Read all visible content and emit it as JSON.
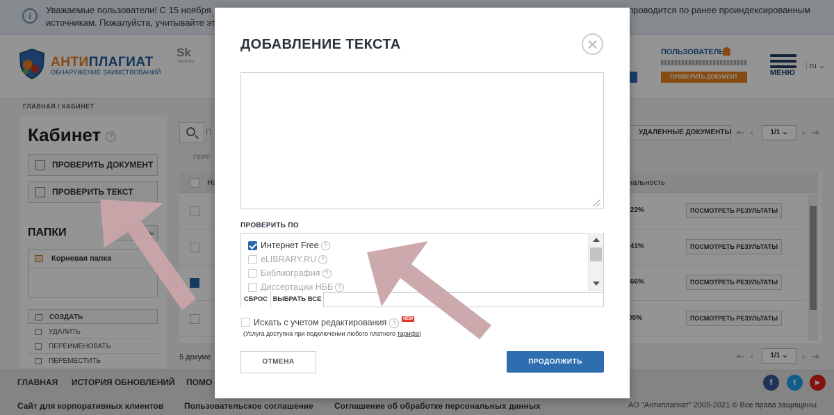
{
  "notice": {
    "line1": "Уважаемые пользователи! С 15 ноября",
    "line2": "источникам. Пожалуйста, учитывайте эт",
    "line_right": "проводится по ранее проиндексированным"
  },
  "header": {
    "logo_title_part1": "АНТИ",
    "logo_title_part2": "ПЛАГИАТ",
    "logo_subtitle": "ОБНАРУЖЕНИЕ ЗАИМСТВОВАНИЙ",
    "partner_logo": "Sk",
    "partner_sub": "Skolkovo",
    "user_label": "ПОЛЬЗОВАТЕЛЬ",
    "check_doc_small": "ПРОВЕРИТЬ ДОКУМЕНТ",
    "menu_label": "МЕНЮ",
    "lang": "ru"
  },
  "breadcrumb": "ГЛАВНАЯ / КАБИНЕТ",
  "sidebar": {
    "title": "Кабинет",
    "check_document": "ПРОВЕРИТЬ ДОКУМЕНТ",
    "check_text": "ПРОВЕРИТЬ ТЕКСТ",
    "folders_title": "ПАПКИ",
    "folders_btn": "менты",
    "root_folder": "Корневая папка",
    "actions": [
      "СОЗДАТЬ",
      "УДАЛИТЬ",
      "ПЕРЕИМЕНОВАТЬ",
      "ПЕРЕМЕСТИТЬ"
    ]
  },
  "main": {
    "search_placeholder": "П",
    "deleted_docs": "УДАЛЕННЫЕ ДОКУМЕНТЫ",
    "page_selector": "1/1",
    "move_label": "ПЕРЕ",
    "name_header": "На",
    "originality_header": "нальность",
    "rows": [
      {
        "pct": ",22%",
        "checked": false,
        "btn": "ПОСМОТРЕТЬ РЕЗУЛЬТАТЫ"
      },
      {
        "pct": ",41%",
        "checked": false,
        "btn": "ПОСМОТРЕТЬ РЕЗУЛЬТАТЫ"
      },
      {
        "pct": ",66%",
        "checked": true,
        "btn": "ПОСМОТРЕТЬ РЕЗУЛЬТАТЫ"
      },
      {
        "pct": "00%",
        "checked": false,
        "btn": "ПОСМОТРЕТЬ РЕЗУЛЬТАТЫ"
      }
    ],
    "doc_count": "5 докуме"
  },
  "footer": {
    "nav": [
      "ГЛАВНАЯ",
      "ИСТОРИЯ ОБНОВЛЕНИЙ",
      "ПОМО"
    ],
    "links": [
      "Сайт для корпоративных клиентов",
      "Пользовательское соглашение",
      "Соглашение об обработке персональных данных"
    ],
    "copyright": "АО \"Антиплагиат\" 2005-2021 © Все права защищены",
    "social": {
      "facebook": "f",
      "twitter": "t",
      "youtube": "▶"
    }
  },
  "modal": {
    "title": "ДОБАВЛЕНИЕ ТЕКСТА",
    "text_value": "",
    "check_by_label": "ПРОВЕРИТЬ ПО",
    "sources": [
      {
        "label": "Интернет Free",
        "checked": true,
        "enabled": true
      },
      {
        "label": "eLIBRARY.RU",
        "checked": false,
        "enabled": false
      },
      {
        "label": "Библиография",
        "checked": false,
        "enabled": false
      },
      {
        "label": "Диссертации НББ",
        "checked": false,
        "enabled": false
      }
    ],
    "reset_btn": "СБРОС",
    "select_all_btn": "ВЫБРАТЬ ВСЕ",
    "edit_search_label": "Искать с учетом редактирования",
    "new_badge": "NEW",
    "service_note_prefix": "(Услуга доступна при подключении любого платного ",
    "service_note_link": "тарифа",
    "service_note_suffix": ")",
    "cancel_btn": "ОТМЕНА",
    "continue_btn": "ПРОДОЛЖИТЬ"
  },
  "colors": {
    "accent_blue": "#2f6db1",
    "brand_orange": "#e8811f",
    "annotation_arrow": "#c9a4a8"
  }
}
